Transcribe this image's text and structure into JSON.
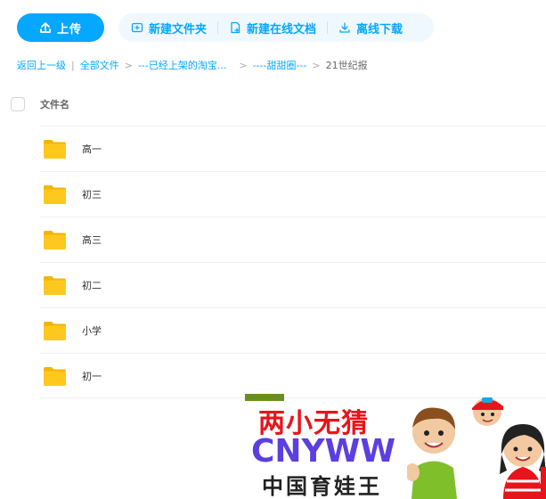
{
  "toolbar": {
    "upload_label": "上传",
    "new_folder_label": "新建文件夹",
    "new_doc_label": "新建在线文档",
    "offline_download_label": "离线下载"
  },
  "breadcrumb": {
    "back": "返回上一级",
    "sep": "|",
    "items": [
      "全部文件",
      "---已经上架的淘宝...",
      "----甜甜圈---",
      "21世纪报"
    ],
    "arrow": ">"
  },
  "list": {
    "column_name": "文件名",
    "rows": [
      {
        "name": "高一",
        "icon": "folder-icon"
      },
      {
        "name": "初三",
        "icon": "folder-icon"
      },
      {
        "name": "高三",
        "icon": "folder-icon"
      },
      {
        "name": "初二",
        "icon": "folder-icon"
      },
      {
        "name": "小学",
        "icon": "folder-icon"
      },
      {
        "name": "初一",
        "icon": "folder-icon"
      }
    ]
  },
  "watermark": {
    "title": "两小无猜",
    "brand": "CNYWW",
    "subtitle": "中国育娃王"
  },
  "colors": {
    "accent": "#06a7ff",
    "folder": "#ffc81e",
    "watermark_red": "#e8141b",
    "watermark_purple": "#5b3fe0"
  }
}
